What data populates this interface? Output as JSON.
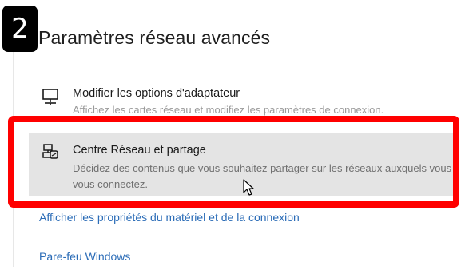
{
  "step_badge": "2",
  "page_title": "Paramètres réseau avancés",
  "options": [
    {
      "icon": "monitor-network-icon",
      "title": "Modifier les options d'adaptateur",
      "description": "Affichez les cartes réseau et modifiez les paramètres de connexion."
    },
    {
      "icon": "network-sharing-icon",
      "title": "Centre Réseau et partage",
      "description": "Décidez des contenus que vous souhaitez partager sur les réseaux auxquels vous vous connectez."
    }
  ],
  "links": {
    "hardware_properties": "Afficher les propriétés du matériel et de la connexion",
    "firewall": "Pare-feu Windows"
  },
  "colors": {
    "highlight": "#ff0000",
    "selected_background": "#e4e4e4",
    "link": "#2b6cb7",
    "badge_background": "#000000"
  }
}
